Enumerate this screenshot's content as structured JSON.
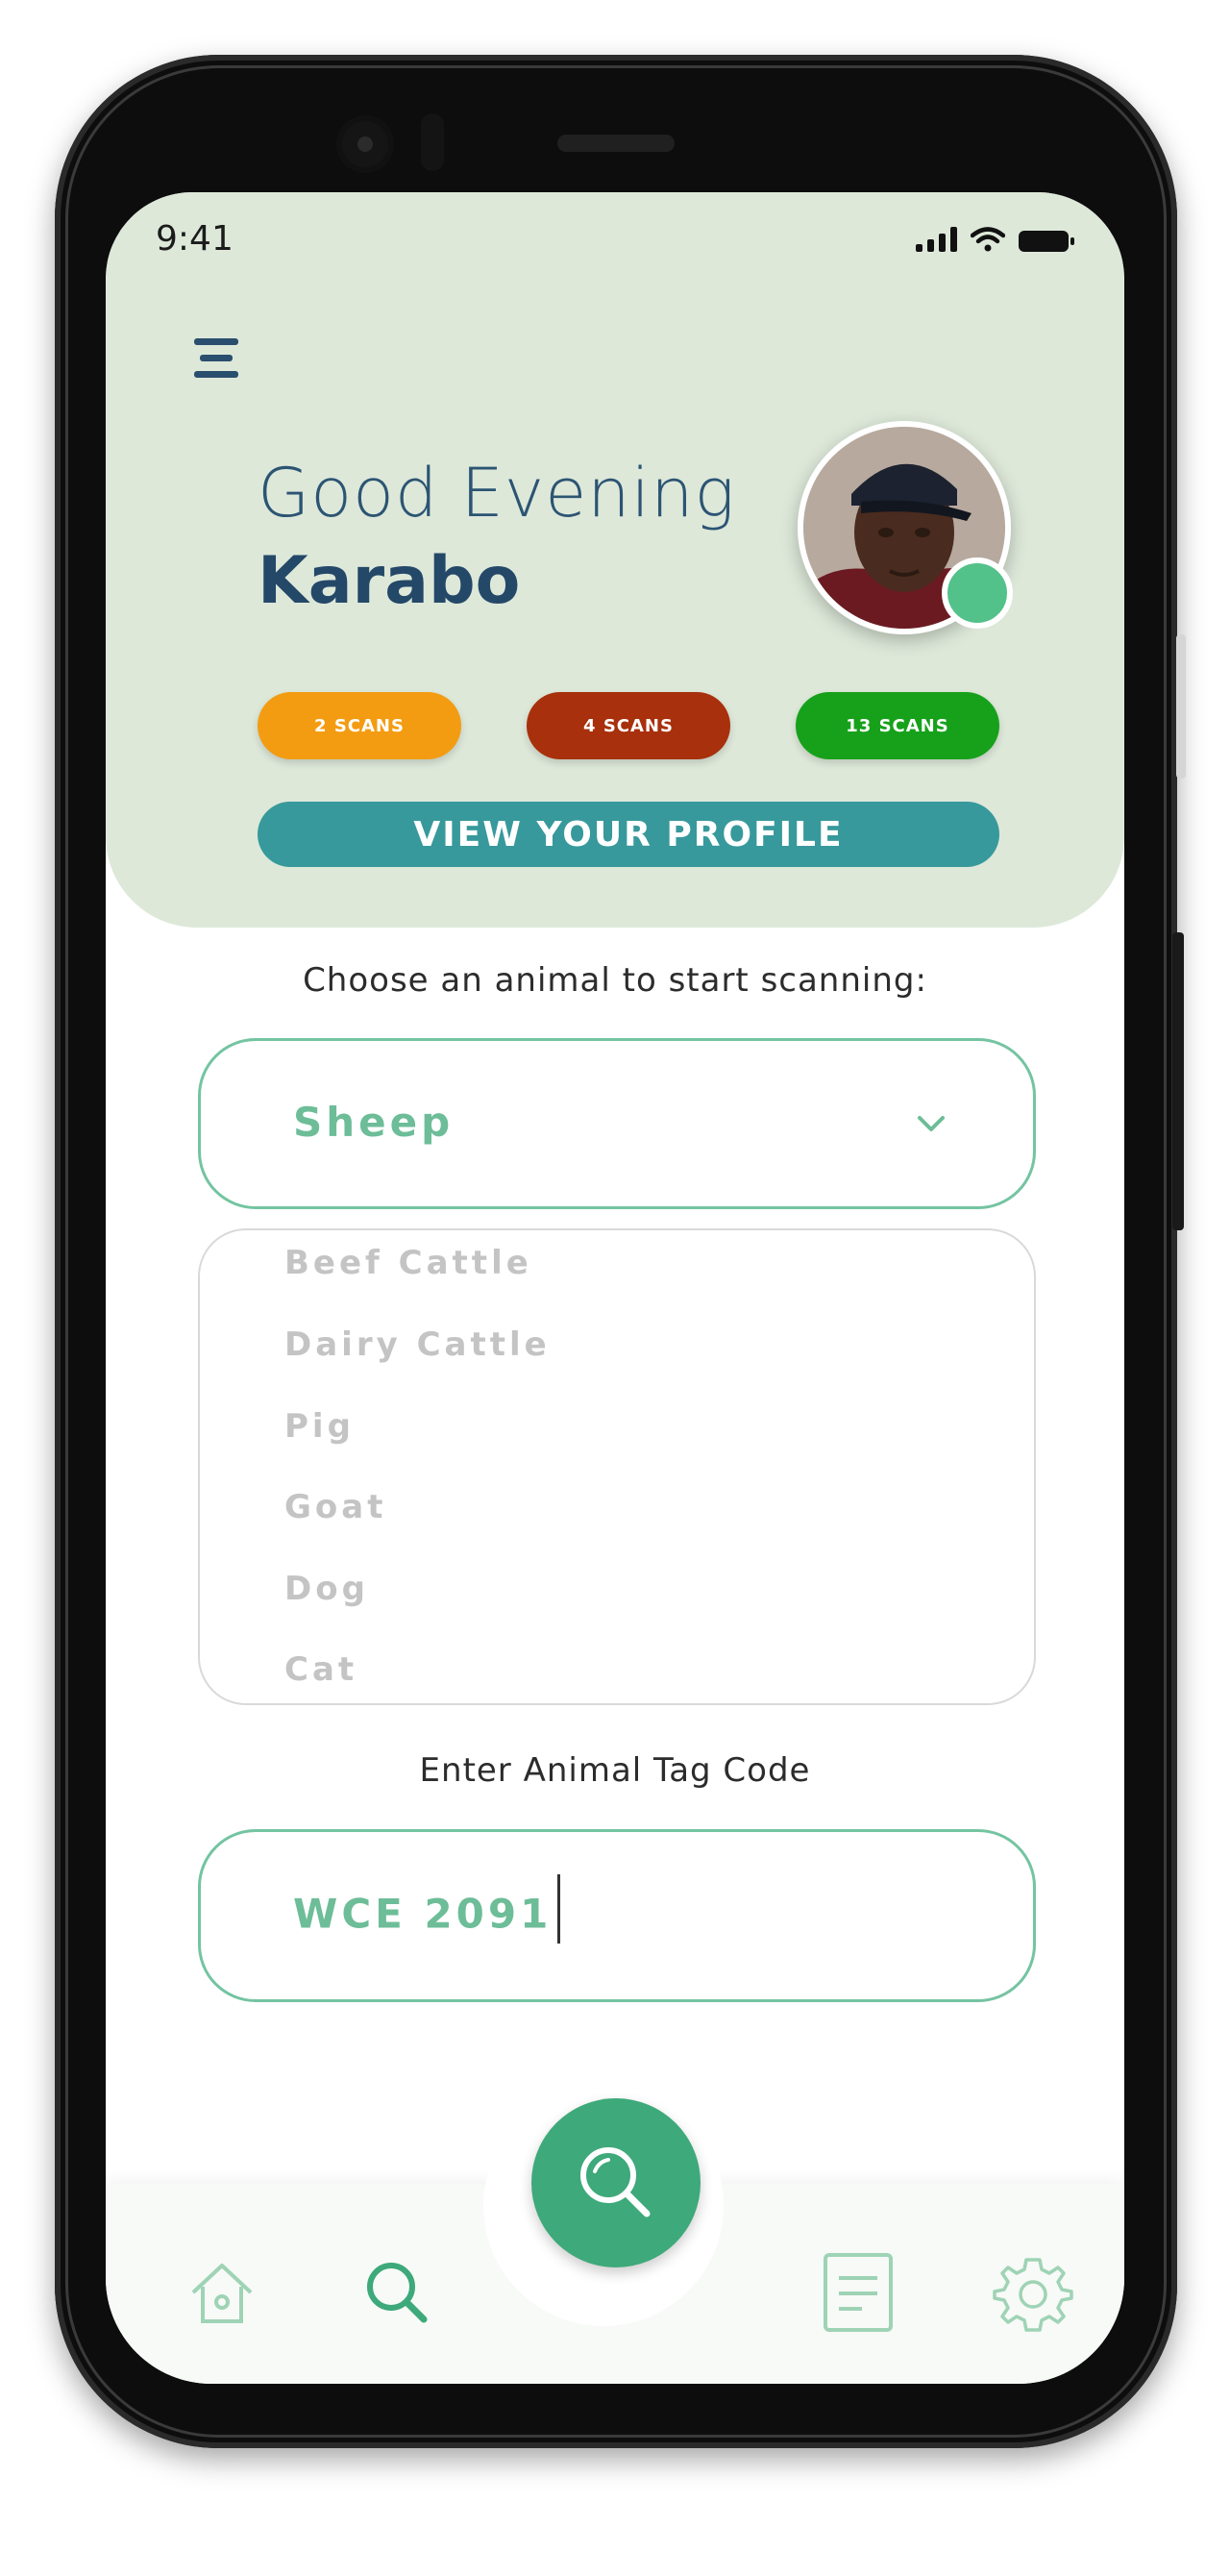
{
  "status_bar": {
    "time": "9:41"
  },
  "header": {
    "greeting": "Good Evening",
    "user_name": "Karabo",
    "scan_pills": [
      {
        "label": "2 SCANS",
        "color": "#f39c12"
      },
      {
        "label": "4 SCANS",
        "color": "#a8300c"
      },
      {
        "label": "13 SCANS",
        "color": "#17a11b"
      }
    ],
    "profile_button": "VIEW YOUR PROFILE"
  },
  "animal_select": {
    "label": "Choose an animal to start scanning:",
    "selected": "Sheep",
    "options": [
      "Beef Cattle",
      "Dairy Cattle",
      "Pig",
      "Goat",
      "Dog",
      "Cat"
    ]
  },
  "tag_code": {
    "label": "Enter Animal Tag Code",
    "value": "WCE 2091"
  },
  "bottom_nav": {
    "items": [
      "home-icon",
      "search-icon",
      "search-fab-icon",
      "document-icon",
      "gear-icon"
    ]
  },
  "colors": {
    "header_bg": "#dde8d9",
    "accent_green": "#3ea97a",
    "teal_button": "#37999b",
    "title_blue": "#2c5473"
  }
}
